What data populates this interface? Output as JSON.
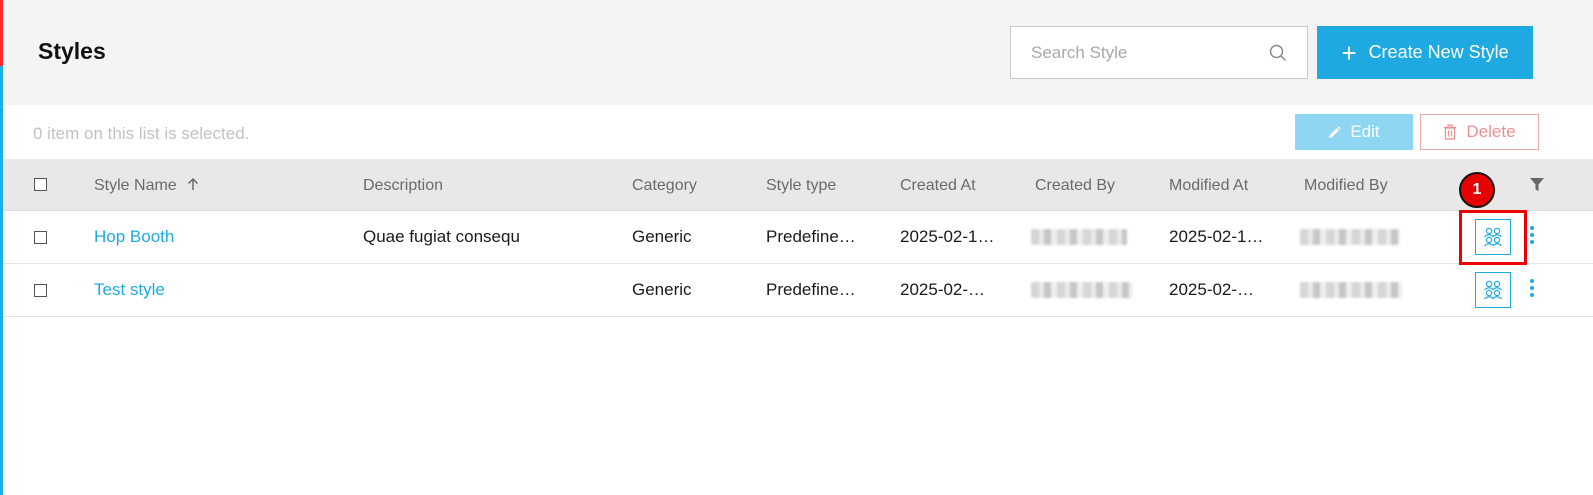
{
  "page": {
    "title": "Styles"
  },
  "search": {
    "placeholder": "Search Style"
  },
  "create_button": {
    "icon": "plus-icon",
    "label": "Create New Style"
  },
  "selection_bar": {
    "status_text": "0 item on this list is selected.",
    "edit_label": "Edit",
    "delete_label": "Delete"
  },
  "table": {
    "columns": [
      "Style Name",
      "Description",
      "Category",
      "Style type",
      "Created At",
      "Created By",
      "Modified At",
      "Modified By"
    ],
    "sort": {
      "column": "Style Name",
      "direction": "ascending"
    },
    "rows": [
      {
        "style_name": "Hop Booth",
        "description": "Quae fugiat consequ",
        "category": "Generic",
        "style_type": "Predefine…",
        "created_at": "2025-02-1…",
        "created_by": "",
        "modified_at": "2025-02-1…",
        "modified_by": ""
      },
      {
        "style_name": "Test style",
        "description": "",
        "category": "Generic",
        "style_type": "Predefine…",
        "created_at": "2025-02-…",
        "created_by": "",
        "modified_at": "2025-02-…",
        "modified_by": ""
      }
    ]
  },
  "annotation": {
    "step_number": "1"
  },
  "colors": {
    "accent": "#1ea9e1",
    "danger": "#ef8f8f",
    "highlight": "#ee0000"
  }
}
